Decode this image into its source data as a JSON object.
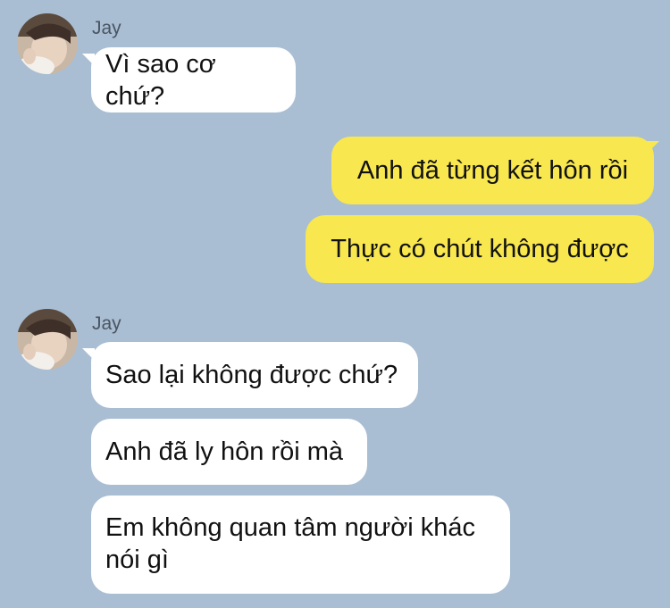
{
  "conversation": {
    "group1": {
      "sender": "Jay",
      "messages": [
        "Vì sao cơ chứ?"
      ]
    },
    "outgoing": {
      "messages": [
        "Anh đã từng kết hôn rồi",
        "Thực có chút không được"
      ]
    },
    "group2": {
      "sender": "Jay",
      "messages": [
        "Sao lại không được chứ?",
        "Anh đã ly hôn rồi mà",
        "Em không quan tâm người khác\nnói gì"
      ]
    }
  },
  "colors": {
    "background": "#a9bed3",
    "incoming_bubble": "#ffffff",
    "outgoing_bubble": "#f8e74e",
    "sender_name": "#4a5562"
  },
  "icons": {
    "avatar": "avatar-photo"
  }
}
